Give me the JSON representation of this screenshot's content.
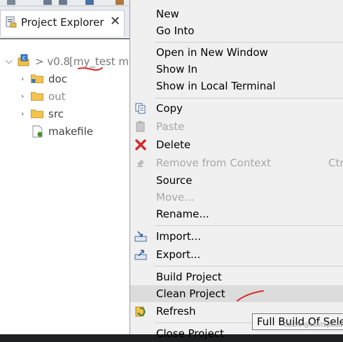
{
  "explorer": {
    "tab_title": "Project Explorer",
    "project": {
      "prefix": "> v0.8",
      "name": "[my_test ma"
    },
    "items": [
      {
        "label": "doc",
        "type": "folder",
        "dim": false
      },
      {
        "label": "out",
        "type": "folder",
        "dim": true
      },
      {
        "label": "src",
        "type": "folder",
        "dim": false
      },
      {
        "label": "makefile",
        "type": "file",
        "dim": false
      }
    ]
  },
  "menu": {
    "items": [
      {
        "key": "new",
        "label": "New"
      },
      {
        "key": "go_into",
        "label": "Go Into"
      },
      {
        "key": "open_new_window",
        "label": "Open in New Window"
      },
      {
        "key": "show_in",
        "label": "Show In"
      },
      {
        "key": "show_local_terminal",
        "label": "Show in Local Terminal"
      },
      {
        "key": "copy",
        "label": "Copy",
        "icon": "copy-icon"
      },
      {
        "key": "paste",
        "label": "Paste",
        "icon": "paste-icon"
      },
      {
        "key": "delete",
        "label": "Delete",
        "icon": "delete-icon"
      },
      {
        "key": "remove_context",
        "label": "Remove from Context",
        "shortcut": "Ctr",
        "icon": "remove-context-icon"
      },
      {
        "key": "source",
        "label": "Source"
      },
      {
        "key": "move",
        "label": "Move..."
      },
      {
        "key": "rename",
        "label": "Rename..."
      },
      {
        "key": "import",
        "label": "Import...",
        "icon": "import-icon"
      },
      {
        "key": "export",
        "label": "Export...",
        "icon": "export-icon"
      },
      {
        "key": "build_project",
        "label": "Build Project"
      },
      {
        "key": "clean_project",
        "label": "Clean Project"
      },
      {
        "key": "refresh",
        "label": "Refresh",
        "icon": "refresh-icon"
      },
      {
        "key": "close_project",
        "label": "Close Project"
      }
    ]
  },
  "tooltip": "Full Build Of Selec",
  "watermark": "CSDN @LostSpeed"
}
